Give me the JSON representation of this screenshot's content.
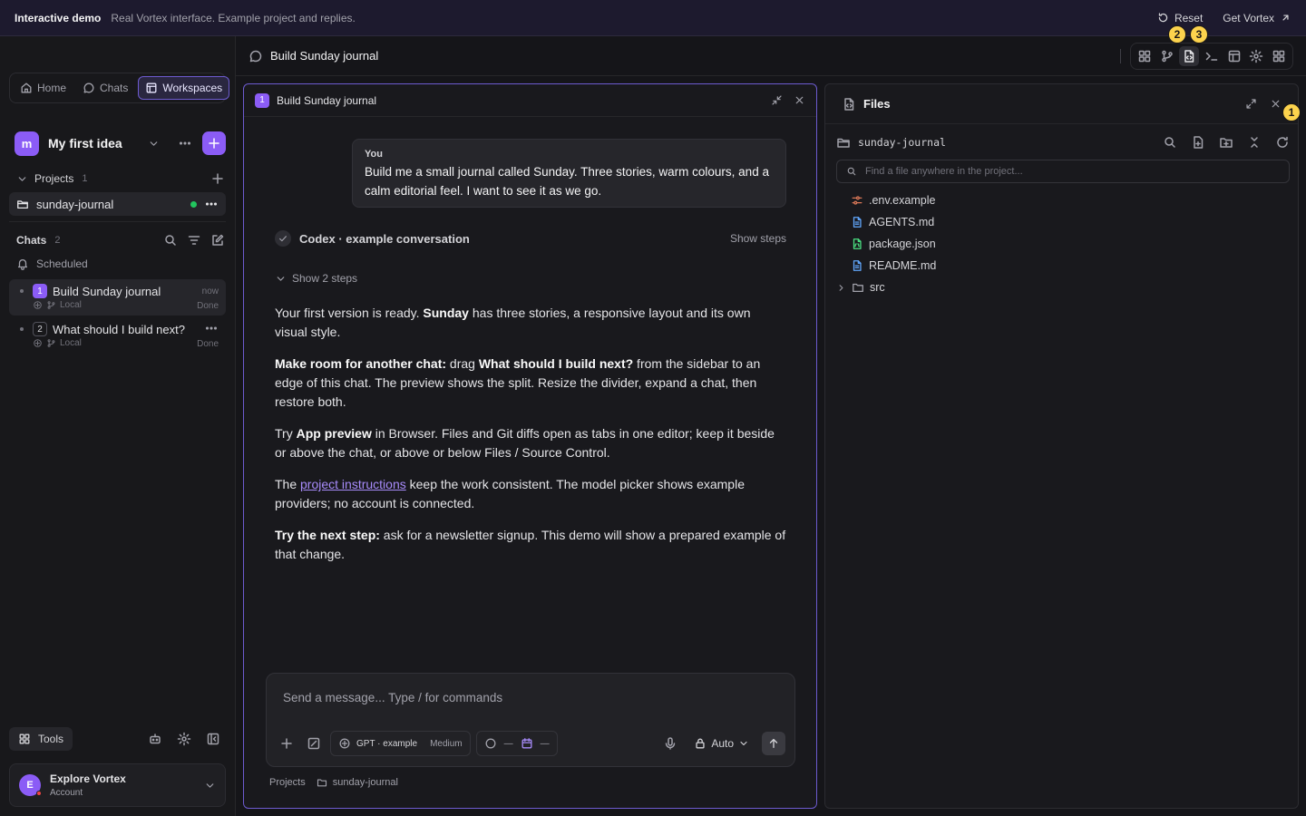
{
  "banner": {
    "title": "Interactive demo",
    "subtitle": "Real Vortex interface. Example project and replies.",
    "reset_label": "Reset",
    "get_label": "Get Vortex"
  },
  "sidebar": {
    "tabs": [
      {
        "label": "Home",
        "icon": "home-icon"
      },
      {
        "label": "Chats",
        "icon": "chat-bubble-icon"
      },
      {
        "label": "Workspaces",
        "icon": "workspace-icon",
        "active": true
      }
    ],
    "workspace": {
      "avatar": "m",
      "name": "My first idea"
    },
    "projects": {
      "label": "Projects",
      "count": "1",
      "items": [
        {
          "name": "sunday-journal",
          "status": "online"
        }
      ]
    },
    "chats": {
      "label": "Chats",
      "count": "2",
      "scheduled_label": "Scheduled",
      "items": [
        {
          "num": "1",
          "title": "Build Sunday journal",
          "location": "Local",
          "time": "now",
          "status": "Done",
          "active": true
        },
        {
          "num": "2",
          "title": "What should I build next?",
          "location": "Local",
          "time": "",
          "status": "Done",
          "active": false
        }
      ]
    },
    "tools_label": "Tools",
    "account": {
      "avatar": "E",
      "name": "Explore Vortex",
      "sub": "Account"
    }
  },
  "topbar": {
    "title": "Build Sunday journal"
  },
  "chat": {
    "pane_num": "1",
    "pane_title": "Build Sunday journal",
    "you_label": "You",
    "user_message": "Build me a small journal called Sunday. Three stories, warm colours, and a calm editorial feel. I want to see it as we go.",
    "agent_title": "Codex · example conversation",
    "show_steps": "Show steps",
    "steps_toggle": "Show 2 steps",
    "reply": {
      "p1_a": "Your first version is ready. ",
      "p1_b": "Sunday",
      "p1_c": " has three stories, a responsive layout and its own visual style.",
      "p2_a": "Make room for another chat:",
      "p2_b": " drag ",
      "p2_c": "What should I build next?",
      "p2_d": " from the sidebar to an edge of this chat. The preview shows the split. Resize the divider, expand a chat, then restore both.",
      "p3_a": "Try ",
      "p3_b": "App preview",
      "p3_c": " in Browser. Files and Git diffs open as tabs in one editor; keep it beside or above the chat, or above or below Files / Source Control.",
      "p4_a": "The ",
      "p4_link": "project instructions",
      "p4_c": " keep the work consistent. The model picker shows example providers; no account is connected.",
      "p5_a": "Try the next step:",
      "p5_b": " ask for a newsletter signup. This demo will show a prepared example of that change."
    },
    "composer": {
      "placeholder": "Send a message... Type / for commands",
      "model": "GPT · example",
      "effort": "Medium",
      "dash1": "—",
      "dash2": "—",
      "mode": "Auto"
    },
    "breadcrumb": {
      "root": "Projects",
      "project": "sunday-journal"
    }
  },
  "files": {
    "title": "Files",
    "root": "sunday-journal",
    "search_placeholder": "Find a file anywhere in the project...",
    "items": [
      {
        "name": ".env.example",
        "icon": "env-settings-icon"
      },
      {
        "name": "AGENTS.md",
        "icon": "markdown-file-icon"
      },
      {
        "name": "package.json",
        "icon": "json-file-icon"
      },
      {
        "name": "README.md",
        "icon": "markdown-file-icon"
      },
      {
        "name": "src",
        "icon": "folder-icon"
      }
    ]
  },
  "badges": [
    "1",
    "2",
    "3"
  ],
  "colors": {
    "accent": "#8b5cf6",
    "badge": "#fcd34d",
    "online": "#22c55e",
    "link": "#a78bfa"
  }
}
